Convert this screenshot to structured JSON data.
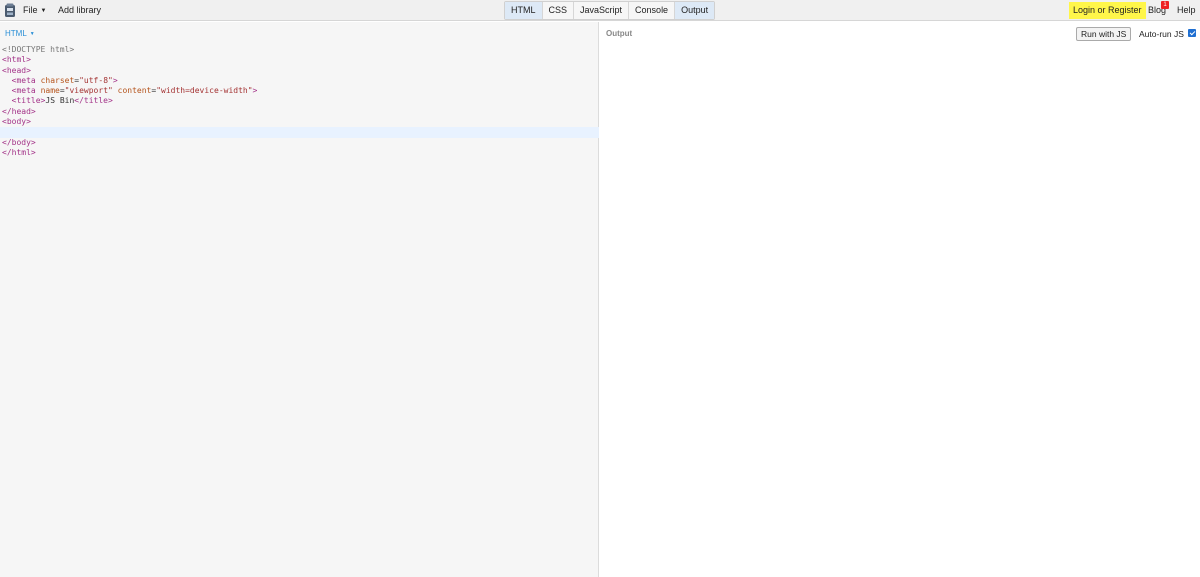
{
  "toolbar": {
    "logo_icon": "jsbin-logo-icon",
    "file_label": "File",
    "add_library_label": "Add library",
    "panel_tabs": [
      {
        "label": "HTML",
        "active": true
      },
      {
        "label": "CSS",
        "active": false
      },
      {
        "label": "JavaScript",
        "active": false
      },
      {
        "label": "Console",
        "active": false
      },
      {
        "label": "Output",
        "active": true
      }
    ],
    "login_label": "Login or Register",
    "blog_label": "Blog",
    "blog_badge": "1",
    "help_label": "Help",
    "login_bg_color": "#fff64a"
  },
  "editor": {
    "language_label": "HTML",
    "code_lines": [
      "<!DOCTYPE html>",
      "<html>",
      "<head>",
      "  <meta charset=\"utf-8\">",
      "  <meta name=\"viewport\" content=\"width=device-width\">",
      "  <title>JS Bin</title>",
      "</head>",
      "<body>",
      "",
      "</body>",
      "</html>"
    ],
    "active_line_index": 8
  },
  "output": {
    "label": "Output",
    "run_button_label": "Run with JS",
    "autorun_label": "Auto-run JS",
    "autorun_checked": true
  }
}
